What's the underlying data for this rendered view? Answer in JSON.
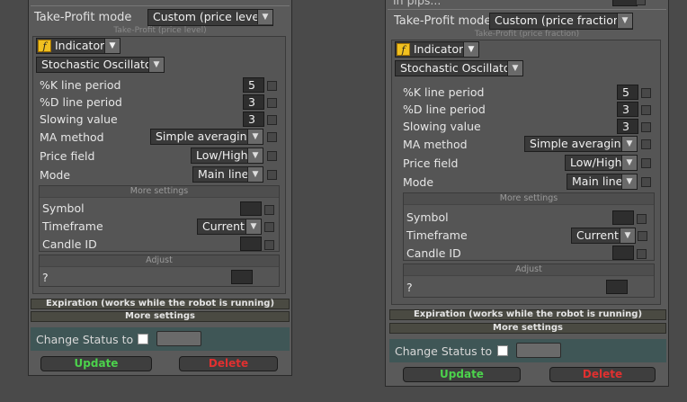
{
  "panels": [
    {
      "mode_label": "Take-Profit mode",
      "mode_value": "Custom (price level)",
      "sub_label": "Take-Profit (price level)",
      "indicator_label": "Indicator",
      "oscillator": "Stochastic Oscillator",
      "k_label": "%K line period",
      "k_value": "5",
      "d_label": "%D line period",
      "d_value": "3",
      "slow_label": "Slowing value",
      "slow_value": "3",
      "ma_label": "MA method",
      "ma_value": "Simple averaging",
      "price_label": "Price field",
      "price_value": "Low/High",
      "mode2_label": "Mode",
      "mode2_value": "Main line",
      "more_settings": "More settings",
      "symbol_label": "Symbol",
      "timeframe_label": "Timeframe",
      "timeframe_value": "Current",
      "candle_label": "Candle ID",
      "adjust_label": "Adjust",
      "q_label": "?",
      "expiration": "Expiration (works while the robot is running)",
      "more_settings2": "More settings",
      "change_status": "Change Status to",
      "update": "Update",
      "delete": "Delete"
    },
    {
      "top_cut": "In pips...",
      "mode_label": "Take-Profit mode",
      "mode_value": "Custom (price fraction)",
      "sub_label": "Take-Profit (price fraction)",
      "indicator_label": "Indicator",
      "oscillator": "Stochastic Oscillator",
      "k_label": "%K line period",
      "k_value": "5",
      "d_label": "%D line period",
      "d_value": "3",
      "slow_label": "Slowing value",
      "slow_value": "3",
      "ma_label": "MA method",
      "ma_value": "Simple averaging",
      "price_label": "Price field",
      "price_value": "Low/High",
      "mode2_label": "Mode",
      "mode2_value": "Main line",
      "more_settings": "More settings",
      "symbol_label": "Symbol",
      "timeframe_label": "Timeframe",
      "timeframe_value": "Current",
      "candle_label": "Candle ID",
      "adjust_label": "Adjust",
      "q_label": "?",
      "expiration": "Expiration (works while the robot is running)",
      "more_settings2": "More settings",
      "change_status": "Change Status to",
      "update": "Update",
      "delete": "Delete"
    }
  ],
  "icons": {
    "dropdown": "chevron-down-icon",
    "function": "function-icon"
  }
}
